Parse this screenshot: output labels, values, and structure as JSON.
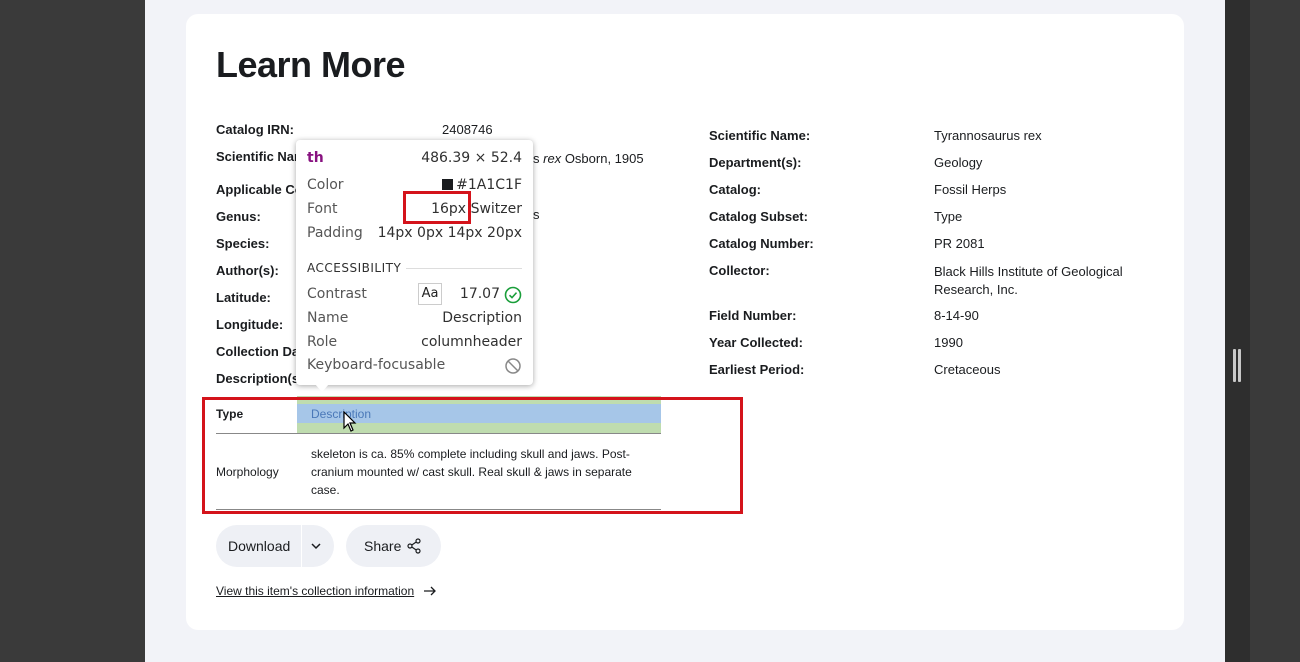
{
  "title": "Learn More",
  "left_fields": [
    {
      "label": "Catalog IRN:",
      "value": "2408746"
    },
    {
      "label": "Scientific Name:",
      "value_italic": "rex",
      "value": "Osborn, 1905",
      "visible_label": "Scientific Nar",
      "visible_value_prefix": "s"
    },
    {
      "label": "Applicable Co",
      "value": ""
    },
    {
      "label": "Genus:",
      "value": "s"
    },
    {
      "label": "Species:",
      "value": ""
    },
    {
      "label": "Author(s):",
      "value": ""
    },
    {
      "label": "Latitude:",
      "value": ""
    },
    {
      "label": "Longitude:",
      "value": ""
    },
    {
      "label": "Collection Da",
      "value": ""
    },
    {
      "label": "Description(s",
      "value": ""
    }
  ],
  "right_fields": [
    {
      "label": "Scientific Name:",
      "value": "Tyrannosaurus rex"
    },
    {
      "label": "Department(s):",
      "value": "Geology"
    },
    {
      "label": "Catalog:",
      "value": "Fossil Herps"
    },
    {
      "label": "Catalog Subset:",
      "value": "Type"
    },
    {
      "label": "Catalog Number:",
      "value": "PR 2081"
    },
    {
      "label": "Collector:",
      "value": "Black Hills Institute of Geological Research, Inc."
    },
    {
      "label": "Field Number:",
      "value": "8-14-90"
    },
    {
      "label": "Year Collected:",
      "value": "1990"
    },
    {
      "label": "Earliest Period:",
      "value": "Cretaceous"
    }
  ],
  "table": {
    "headers": [
      "Type",
      "Description"
    ],
    "rows": [
      {
        "type": "Morphology",
        "description": "skeleton is ca. 85% complete including skull and jaws. Post-cranium mounted w/ cast skull. Real skull & jaws in separate case."
      }
    ]
  },
  "buttons": {
    "download": "Download",
    "share": "Share"
  },
  "link": "View this item's collection information",
  "inspector": {
    "tag": "th",
    "dimensions": "486.39 × 52.4",
    "color_label": "Color",
    "color_value": "#1A1C1F",
    "font_label": "Font",
    "font_size": "16px",
    "font_name": "Switzer",
    "padding_label": "Padding",
    "padding_value": "14px 0px 14px 20px",
    "accessibility_heading": "ACCESSIBILITY",
    "contrast_label": "Contrast",
    "contrast_sample": "Aa",
    "contrast_value": "17.07",
    "name_label": "Name",
    "name_value": "Description",
    "role_label": "Role",
    "role_value": "columnheader",
    "keyboard_label": "Keyboard-focusable"
  },
  "colors": {
    "text": "#1A1C1F",
    "highlight_red": "#d4131b",
    "tag_purple": "#881280",
    "contrast_pass": "#1a9e3a"
  }
}
